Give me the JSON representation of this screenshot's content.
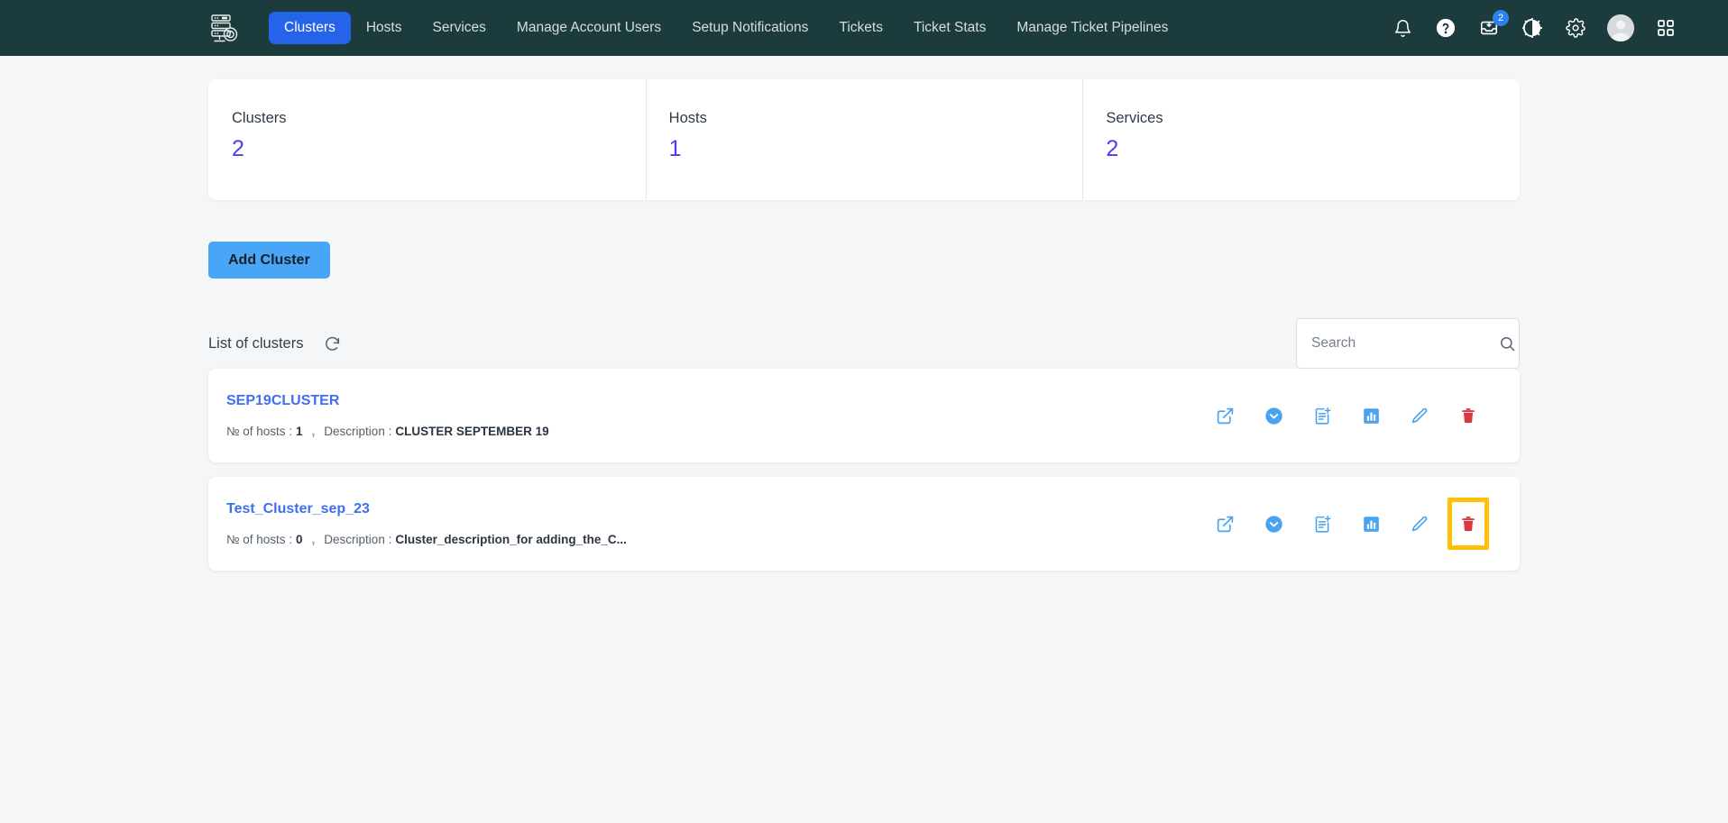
{
  "navbar": {
    "logo_icon": "server-rack-logo",
    "links": [
      {
        "label": "Clusters",
        "active": true
      },
      {
        "label": "Hosts",
        "active": false
      },
      {
        "label": "Services",
        "active": false
      },
      {
        "label": "Manage Account Users",
        "active": false
      },
      {
        "label": "Setup Notifications",
        "active": false
      },
      {
        "label": "Tickets",
        "active": false
      },
      {
        "label": "Ticket Stats",
        "active": false
      },
      {
        "label": "Manage Ticket Pipelines",
        "active": false
      }
    ],
    "icons": {
      "notifications": "bell-icon",
      "help": "help-circle-icon",
      "inbox": "inbox-download-icon",
      "inbox_badge": "2",
      "theme": "dark-mode-toggle-icon",
      "settings": "gear-icon",
      "avatar": "user-avatar",
      "apps": "apps-grid-icon"
    },
    "active_accent": "#2563eb",
    "background": "#1b3b3c"
  },
  "stats": [
    {
      "label": "Clusters",
      "value": "2"
    },
    {
      "label": "Hosts",
      "value": "1"
    },
    {
      "label": "Services",
      "value": "2"
    }
  ],
  "stat_value_color": "#4d3cf0",
  "toolbar": {
    "add_cluster_label": "Add Cluster",
    "add_cluster_color": "#49a5f5"
  },
  "list": {
    "title": "List of clusters",
    "refresh_icon": "refresh-icon",
    "search": {
      "placeholder": "Search",
      "value": "",
      "icon": "search-icon"
    },
    "labels": {
      "hosts_prefix": "№ of hosts :",
      "separator": ",",
      "description_prefix": "Description :"
    },
    "row_actions": [
      {
        "name": "open-external",
        "icon": "external-link-icon",
        "color": "#4aa3f0"
      },
      {
        "name": "expand",
        "icon": "chevron-down-circle-icon",
        "color": "#4aa3f0"
      },
      {
        "name": "add-document",
        "icon": "document-add-icon",
        "color": "#4aa3f0"
      },
      {
        "name": "statistics",
        "icon": "bar-chart-icon",
        "color": "#4aa3f0"
      },
      {
        "name": "edit",
        "icon": "pencil-icon",
        "color": "#4aa3f0"
      },
      {
        "name": "delete",
        "icon": "trash-icon",
        "color": "#d7373f"
      }
    ],
    "highlight_color": "#ffc107",
    "clusters": [
      {
        "name": "SEP19CLUSTER",
        "hosts": "1",
        "description": "CLUSTER SEPTEMBER 19",
        "delete_highlighted": false
      },
      {
        "name": "Test_Cluster_sep_23",
        "hosts": "0",
        "description": "Cluster_description_for adding_the_C...",
        "delete_highlighted": true
      }
    ]
  }
}
